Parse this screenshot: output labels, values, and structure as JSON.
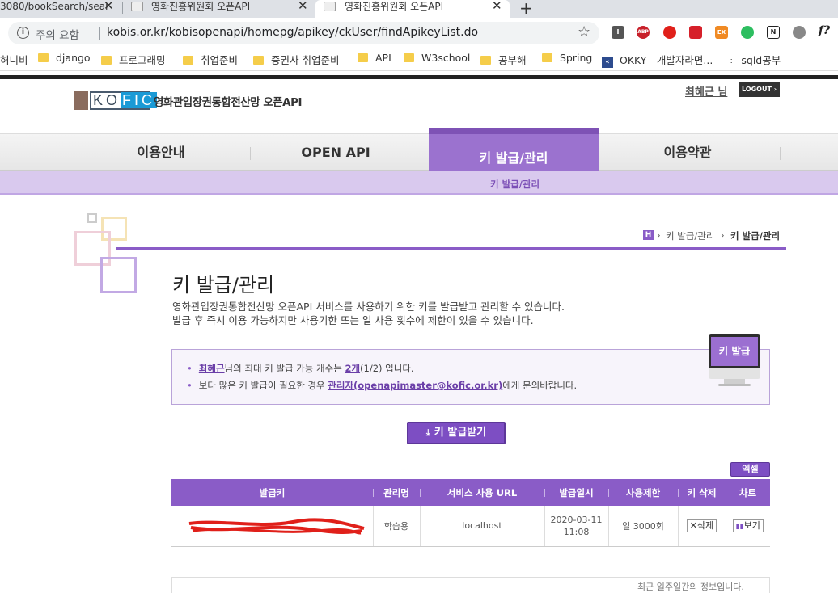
{
  "browser": {
    "tabs": [
      {
        "title": "3080/bookSearch/sear"
      },
      {
        "title": "영화진흥위원회 오픈API"
      },
      {
        "title": "영화진흥위원회 오픈API"
      }
    ],
    "new_tab": "+",
    "security_label": "주의 요함",
    "url": "kobis.or.kr/kobisopenapi/homepg/apikey/ckUser/findApikeyList.do",
    "extensions": [
      "I",
      "ABP",
      "",
      "",
      "EX",
      "",
      "N",
      "",
      "f?"
    ],
    "bookmarks": [
      "허니비",
      "django",
      "프로그래밍",
      "취업준비",
      "증권사 취업준비",
      "API",
      "W3school",
      "공부해",
      "Spring",
      "OKKY - 개발자라면...",
      "sqld공부"
    ]
  },
  "header": {
    "logo_letters": "KOFIC",
    "site_name": "영화관입장권통합전산망 오픈API",
    "user": "최혜근 님",
    "logout": "LOGOUT ›"
  },
  "menu": {
    "items": [
      "이용안내",
      "OPEN API",
      "키 발급/관리",
      "이용약관"
    ],
    "active": 2,
    "submenu": "키 발급/관리"
  },
  "breadcrumb": [
    "H",
    "›",
    "키 발급/관리",
    "›",
    "키 발급/관리"
  ],
  "page": {
    "title": "키 발급/관리",
    "desc1": "영화관입장권통합전산망 오픈API 서비스를 사용하기 위한 키를 발급받고 관리할 수 있습니다.",
    "desc2": "발급 후 즉시 이용 가능하지만 사용기한 또는 일 사용 횟수에 제한이 있을 수 있습니다."
  },
  "info": {
    "line1_user": "최혜근",
    "line1_mid": "님의 최대 키 발급 가능 개수는 ",
    "line1_count": "2개",
    "line1_end": "(1/2) 입니다.",
    "line2_start": "보다 많은 키 발급이 필요한 경우 ",
    "line2_admin": "관리자(openapimaster@kofic.or.kr)",
    "line2_end": "에게 문의바랍니다.",
    "monitor_label": "키 발급"
  },
  "issue_button": "키 발급받기",
  "excel_button": "엑셀",
  "table": {
    "headers": [
      "발급키",
      "관리명",
      "서비스 사용 URL",
      "발급일시",
      "사용제한",
      "키 삭제",
      "차트"
    ],
    "rows": [
      {
        "key": "",
        "name": "학습용",
        "url": "localhost",
        "date": "2020-03-11",
        "time": "11:08",
        "limit": "일 3000회",
        "delete": "삭제",
        "chart": "보기"
      }
    ]
  },
  "footer_text": "최근 일주일간의 정보입니다."
}
